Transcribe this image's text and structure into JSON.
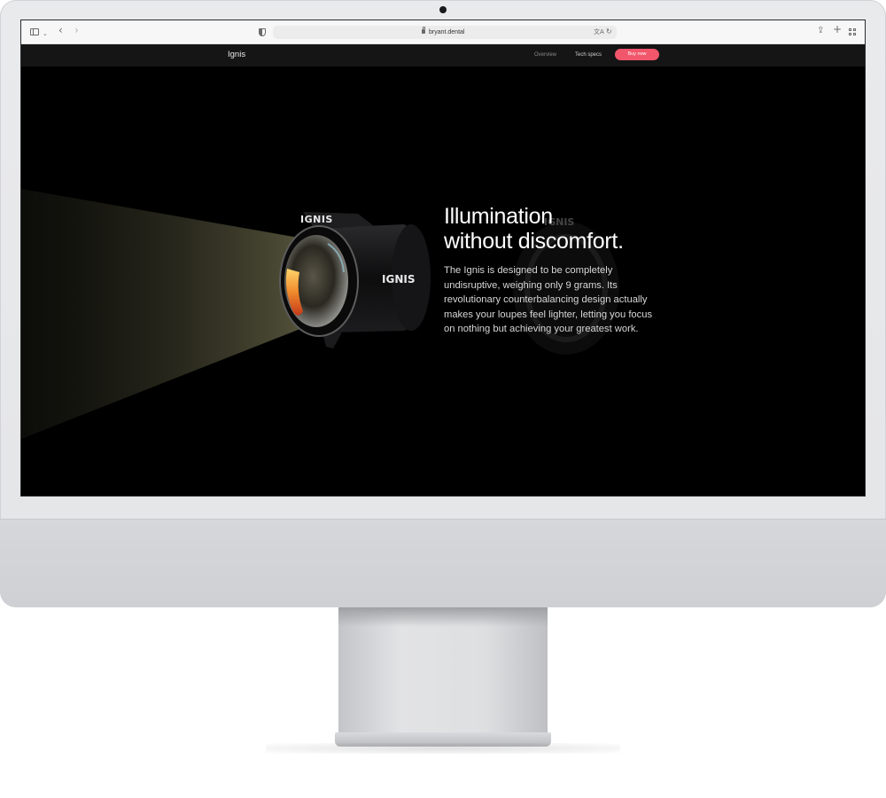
{
  "browser": {
    "url": "bryant.dental",
    "icons": [
      "sidebar-icon",
      "chevron-down-icon",
      "back-icon",
      "forward-icon",
      "shield-icon",
      "lock-icon",
      "translate-icon",
      "reload-icon",
      "share-icon",
      "plus-icon",
      "tabs-grid-icon"
    ]
  },
  "site": {
    "brand": "Ignis",
    "nav": {
      "overview": "Overview",
      "tech_specs": "Tech specs",
      "buy_now": "Buy now"
    },
    "accent_color": "#f2566a"
  },
  "hero": {
    "headline_line1": "Illumination",
    "headline_line2": "without discomfort.",
    "body": "The Ignis is designed to be completely undisruptive, weighing only 9 grams. Its revolutionary counterbalancing design actually makes your loupes feel lighter, letting you focus on nothing but achieving your greatest work.",
    "product_logo": "IGNIS"
  }
}
